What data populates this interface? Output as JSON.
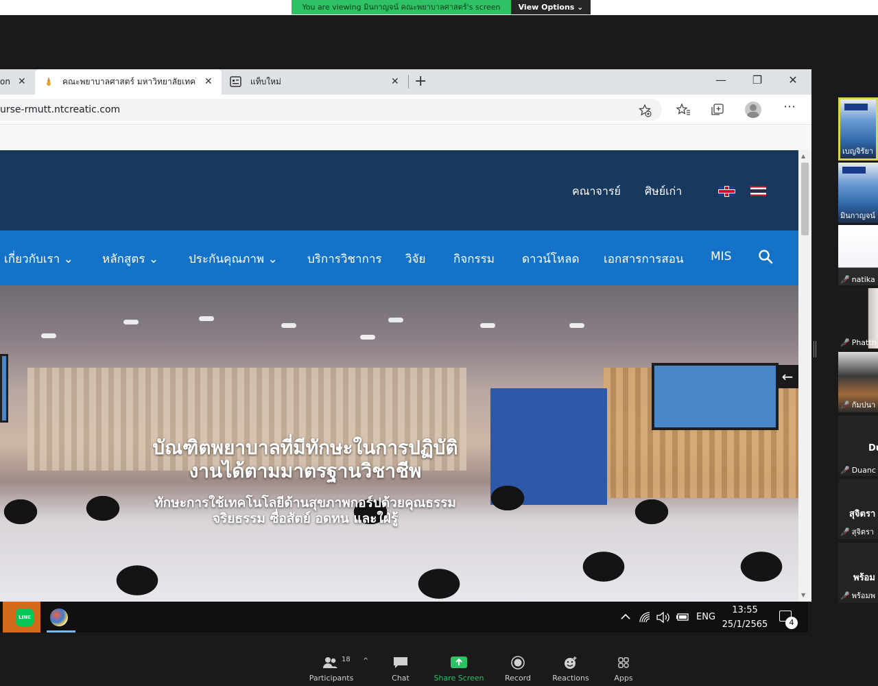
{
  "zoom": {
    "banner": {
      "viewing_text": "You are viewing มินกาญจน์ คณะพยาบาลศาสตร์'s screen",
      "view_options_label": "View Options ⌄"
    },
    "toolbar": {
      "participants_label": "Participants",
      "participants_count": "18",
      "chat_label": "Chat",
      "share_label": "Share Screen",
      "record_label": "Record",
      "reactions_label": "Reactions",
      "apps_label": "Apps"
    },
    "participants": [
      {
        "name": "เบญจิรัยา น",
        "muted": false
      },
      {
        "name": "มินกาญจน์",
        "muted": false
      },
      {
        "name": "natika",
        "muted": true
      },
      {
        "name": "Phatth",
        "muted": true
      },
      {
        "name": "กัมปนา",
        "muted": true
      },
      {
        "name": "Duanc",
        "big_name": "Du",
        "muted": true
      },
      {
        "name": "สุจิตรา",
        "big_name": "สุจิตรา",
        "muted": true
      },
      {
        "name": "พร้อมพ",
        "big_name": "พร้อม",
        "muted": true
      }
    ]
  },
  "browser": {
    "tabs": [
      {
        "title": "on",
        "close": "✕"
      },
      {
        "title": "คณะพยาบาลศาสตร์ มหาวิทยาลัยเทคโ",
        "close": "✕"
      },
      {
        "title": "แท็บใหม่",
        "close": "✕"
      }
    ],
    "new_tab_label": "+",
    "window_controls": {
      "minimize": "—",
      "restore": "❐",
      "close": "✕"
    },
    "url": "urse-rmutt.ntcreatic.com",
    "toolbar_icons": [
      "add-favorite-icon",
      "favorites-icon",
      "collections-icon",
      "profile-icon",
      "more-icon"
    ]
  },
  "website": {
    "top_links": [
      "คณาจารย์",
      "ศิษย์เก่า"
    ],
    "nav": [
      {
        "label": "เกี่ยวกับเรา ⌄"
      },
      {
        "label": "หลักสูตร ⌄"
      },
      {
        "label": "ประกันคุณภาพ ⌄"
      },
      {
        "label": "บริการวิชาการ"
      },
      {
        "label": "วิจัย"
      },
      {
        "label": "กิจกรรม"
      },
      {
        "label": "ดาวน์โหลด"
      },
      {
        "label": "เอกสารการสอน"
      },
      {
        "label": "MIS"
      }
    ],
    "hero": {
      "headline_line1": "บัณฑิตพยาบาลที่มีทักษะในการปฏิบัติ",
      "headline_line2": "งานได้ตามมาตรฐานวิชาชีพ",
      "subline1": "ทักษะการใช้เทคโนโลยีด้านสุขภาพกอร์ปด้วยคุณธรรม",
      "subline2": "จริยธรรม ซื่อสัตย์ อดทน และใฝ่รู้",
      "arrow": "←"
    }
  },
  "taskbar": {
    "line_label": "LINE",
    "language": "ENG",
    "time": "13:55",
    "date": "25/1/2565",
    "notification_count": "4"
  }
}
